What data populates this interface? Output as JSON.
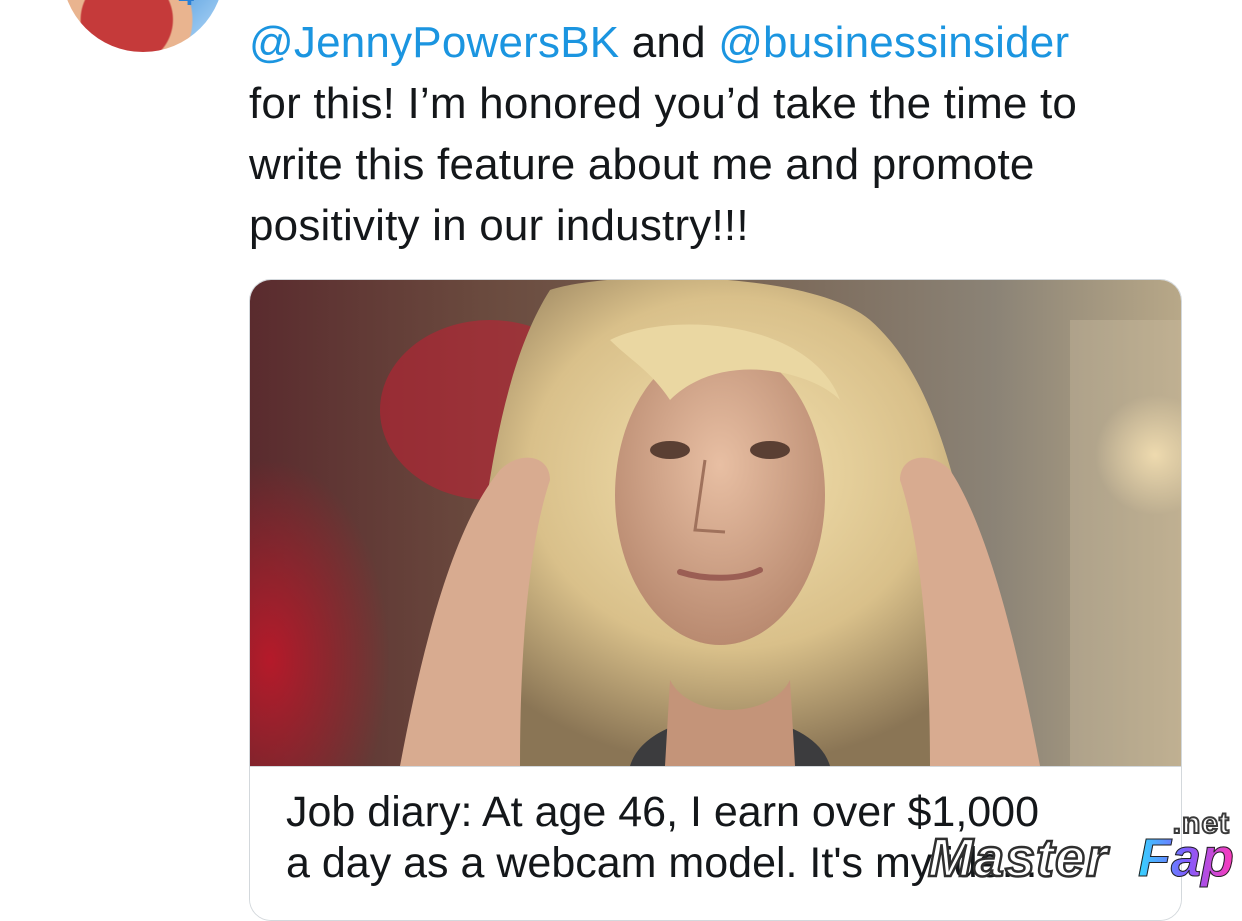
{
  "tweet": {
    "mention_1": "@JennyPowersBK",
    "connector": "and",
    "mention_2": "@businessinsider",
    "line_2": "for this! I’m honored you’d take the time to",
    "line_3": "write this feature about me and promote",
    "line_4": "positivity in our industry!!!"
  },
  "link_card": {
    "title_line_1": "Job diary: At age 46, I earn over $1,000",
    "title_line_2": "a day as a webcam model. It's my ide..."
  },
  "watermark": {
    "net": ".net",
    "master": "Master",
    "fap": "Fap"
  },
  "colors": {
    "mention": "#1b95e0",
    "text": "#14171a",
    "card_border": "#d3d8dc"
  },
  "icons": {
    "avatar": "profile-photo"
  }
}
